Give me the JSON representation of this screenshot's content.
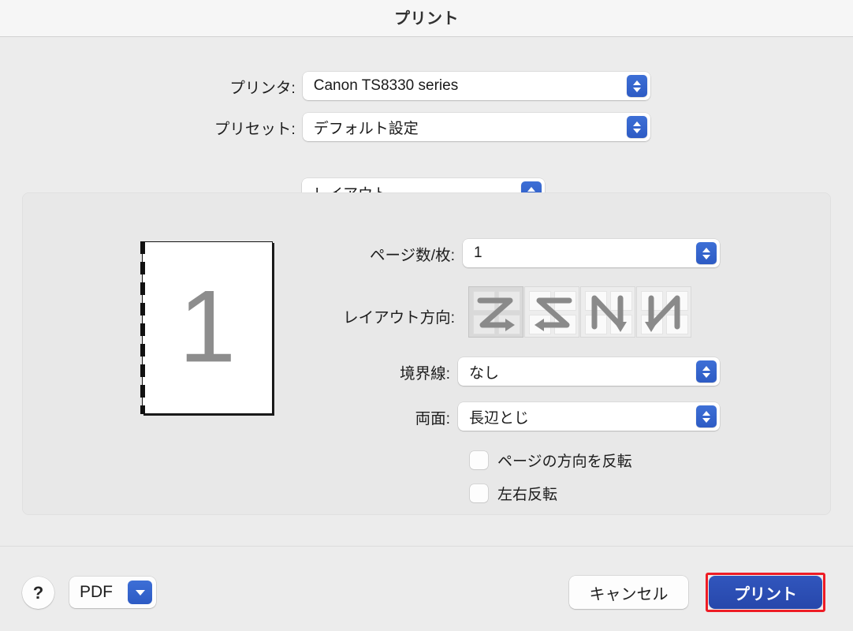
{
  "window": {
    "title": "プリント"
  },
  "header": {
    "printer_label": "プリンタ:",
    "printer_value": "Canon TS8330 series",
    "preset_label": "プリセット:",
    "preset_value": "デフォルト設定"
  },
  "pane_selector": {
    "value": "レイアウト"
  },
  "preview": {
    "page_number": "1"
  },
  "layout": {
    "pages_per_sheet_label": "ページ数/枚:",
    "pages_per_sheet_value": "1",
    "direction_label": "レイアウト方向:",
    "directions": [
      {
        "name": "horizontal-then-down-left-to-right",
        "selected": true
      },
      {
        "name": "horizontal-then-down-right-to-left",
        "selected": false
      },
      {
        "name": "vertical-then-across-bottom-to-top",
        "selected": false
      },
      {
        "name": "vertical-then-across-top-to-bottom",
        "selected": false
      }
    ],
    "border_label": "境界線:",
    "border_value": "なし",
    "two_sided_label": "両面:",
    "two_sided_value": "長辺とじ",
    "reverse_orientation_label": "ページの方向を反転",
    "reverse_orientation_checked": false,
    "flip_horizontally_label": "左右反転",
    "flip_horizontally_checked": false
  },
  "footer": {
    "help_label": "?",
    "pdf_label": "PDF",
    "cancel_label": "キャンセル",
    "print_label": "プリント"
  },
  "colors": {
    "accent_blue": "#2d5bc4",
    "print_button_blue": "#2b4cb2",
    "highlight_red": "#ee1c25",
    "window_bg": "#ececec",
    "panel_bg": "#e8e8e8",
    "titlebar_bg": "#f6f6f6"
  }
}
